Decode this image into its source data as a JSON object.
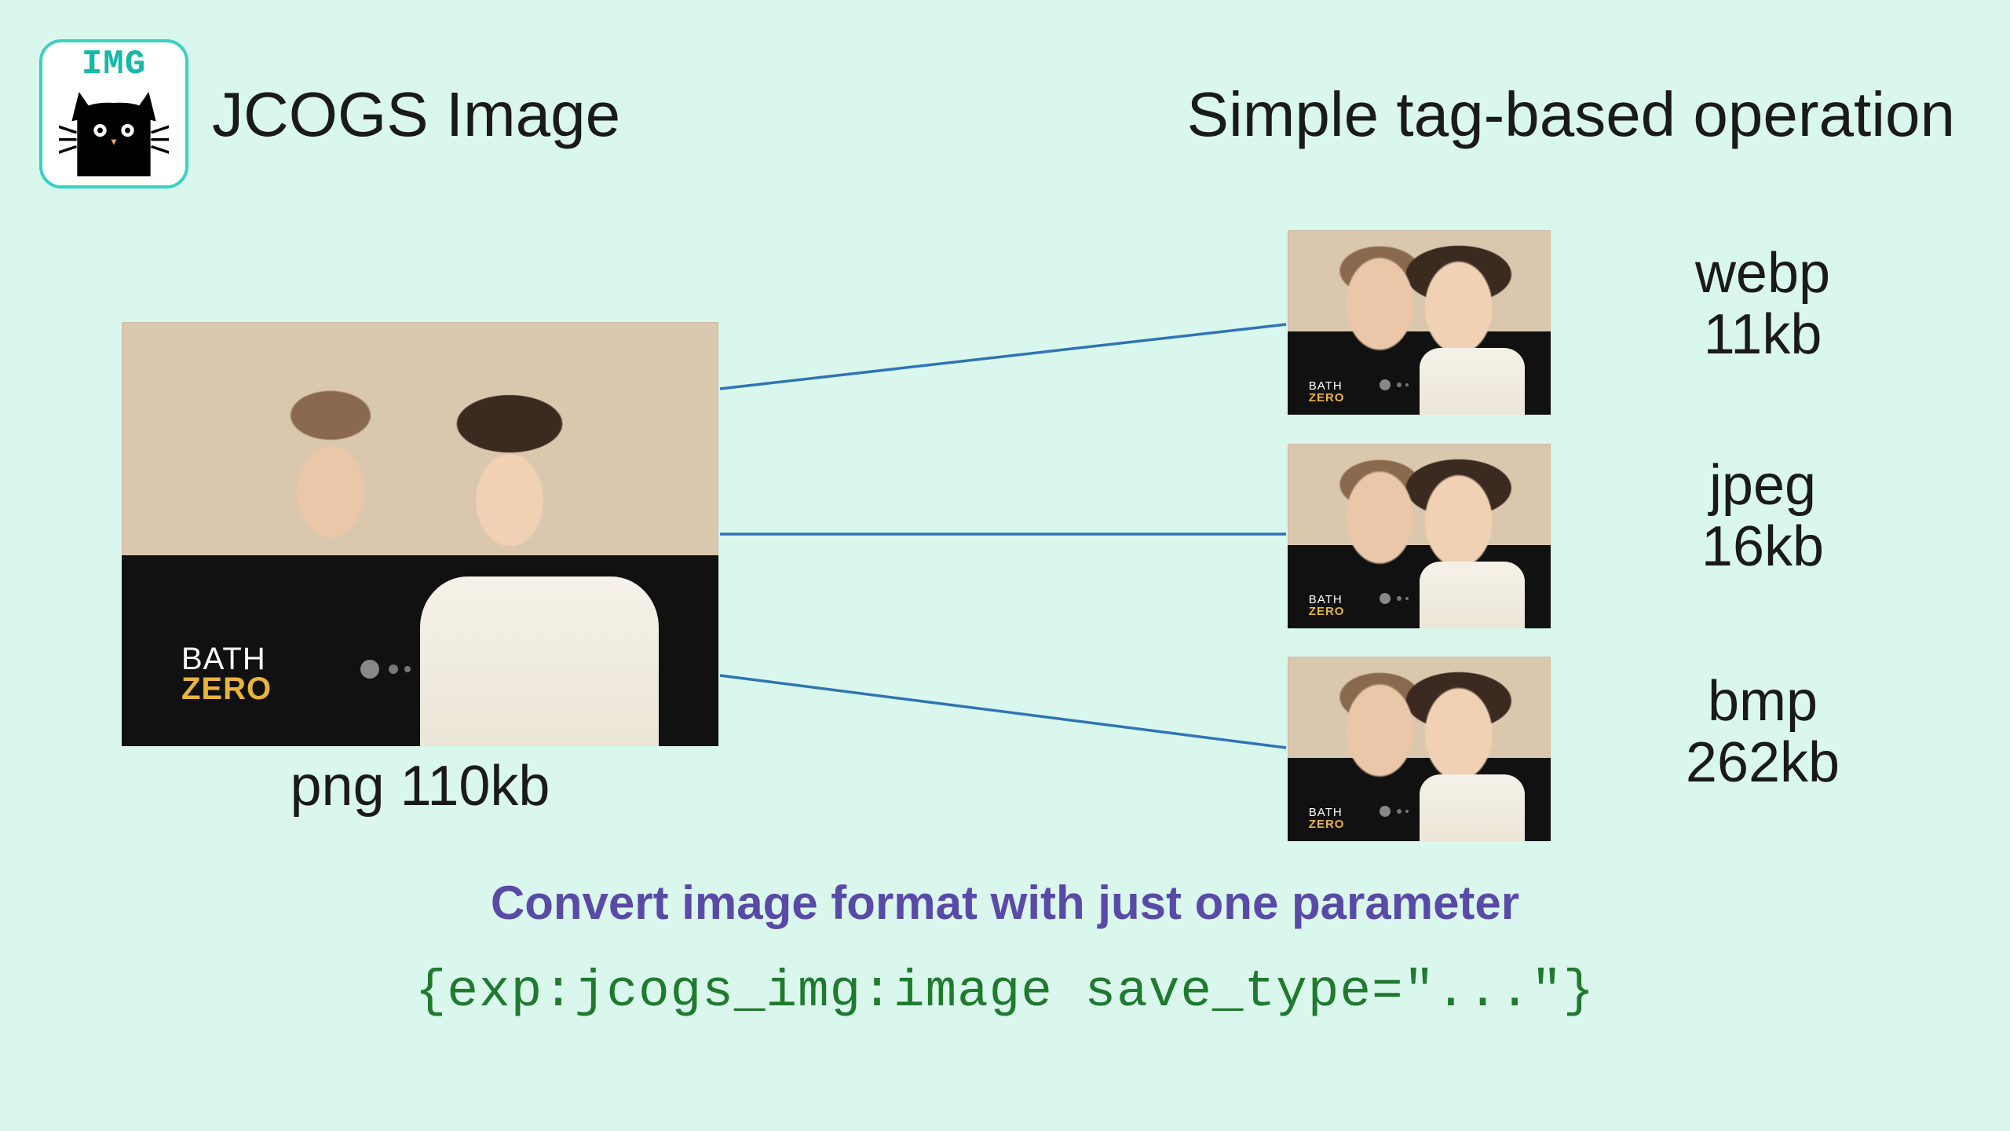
{
  "logo": {
    "img_label": "IMG"
  },
  "brand": "JCOGS Image",
  "tagline": "Simple tag-based operation",
  "source": {
    "caption": "png 110kb"
  },
  "shirt": {
    "line1": "BATH",
    "line2": "ZERO"
  },
  "outputs": [
    {
      "format": "webp",
      "size": "11kb"
    },
    {
      "format": "jpeg",
      "size": "16kb"
    },
    {
      "format": "bmp",
      "size": "262kb"
    }
  ],
  "headline": "Convert image format with just one parameter",
  "code": "{exp:jcogs_img:image save_type=\"...\"}"
}
